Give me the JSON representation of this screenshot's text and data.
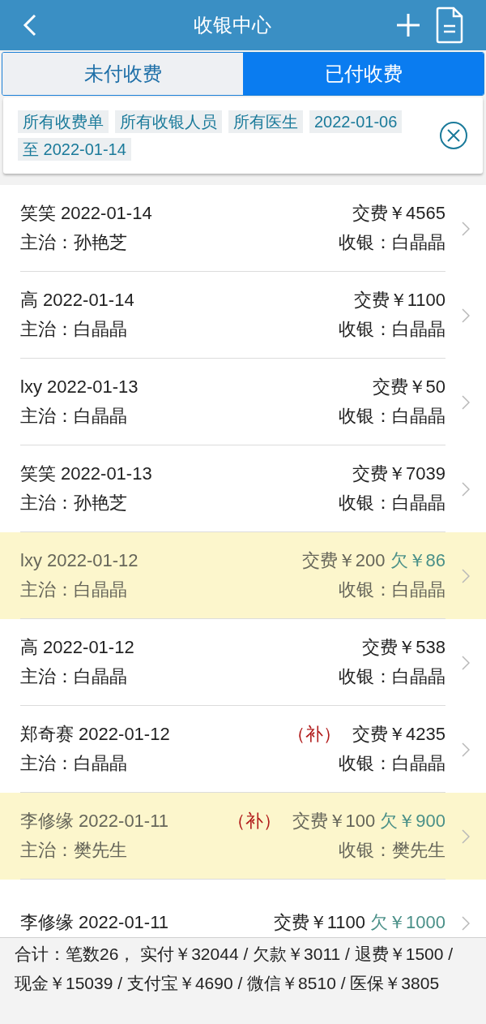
{
  "header": {
    "title": "收银中心"
  },
  "tabs": [
    {
      "label": "未付收费",
      "selected": false
    },
    {
      "label": "已付收费",
      "selected": true
    }
  ],
  "filters": [
    "所有收费单",
    "所有收银人员",
    "所有医生",
    "2022-01-06",
    "至 2022-01-14"
  ],
  "records": [
    {
      "title": "笑笑 2022-01-14",
      "paid": "交费￥4565",
      "doctor": "主治：孙艳芝",
      "cashier": "收银：白晶晶",
      "highlighted": false
    },
    {
      "title": "高 2022-01-14",
      "paid": "交费￥1100",
      "doctor": "主治：白晶晶",
      "cashier": "收银：白晶晶",
      "highlighted": false
    },
    {
      "title": "lxy 2022-01-13",
      "paid": "交费￥50",
      "doctor": "主治：白晶晶",
      "cashier": "收银：白晶晶",
      "highlighted": false
    },
    {
      "title": "笑笑 2022-01-13",
      "paid": "交费￥7039",
      "doctor": "主治：孙艳芝",
      "cashier": "收银：白晶晶",
      "highlighted": false
    },
    {
      "title": "lxy 2022-01-12",
      "paid": "交费￥200",
      "owed": "欠￥86",
      "doctor": "主治：白晶晶",
      "cashier": "收银：白晶晶",
      "highlighted": true
    },
    {
      "title": "高 2022-01-12",
      "paid": "交费￥538",
      "doctor": "主治：白晶晶",
      "cashier": "收银：白晶晶",
      "highlighted": false
    },
    {
      "title": "郑奇赛 2022-01-12",
      "tag": "（补）",
      "paid": "交费￥4235",
      "doctor": "主治：白晶晶",
      "cashier": "收银：白晶晶",
      "highlighted": false
    },
    {
      "title": "李修缘 2022-01-11",
      "tag": "（补）",
      "paid": "交费￥100",
      "owed": "欠￥900",
      "doctor": "主治：樊先生",
      "cashier": "收银：樊先生",
      "highlighted": true
    },
    {
      "title": "李修缘 2022-01-11",
      "paid": "交费￥1100",
      "owed": "欠￥1000",
      "highlighted": false
    }
  ],
  "summary": "合计：笔数26， 实付￥32044 / 欠款￥3011 / 退费￥1500 / 现金￥15039 / 支付宝￥4690 / 微信￥8510 / 医保￥3805"
}
